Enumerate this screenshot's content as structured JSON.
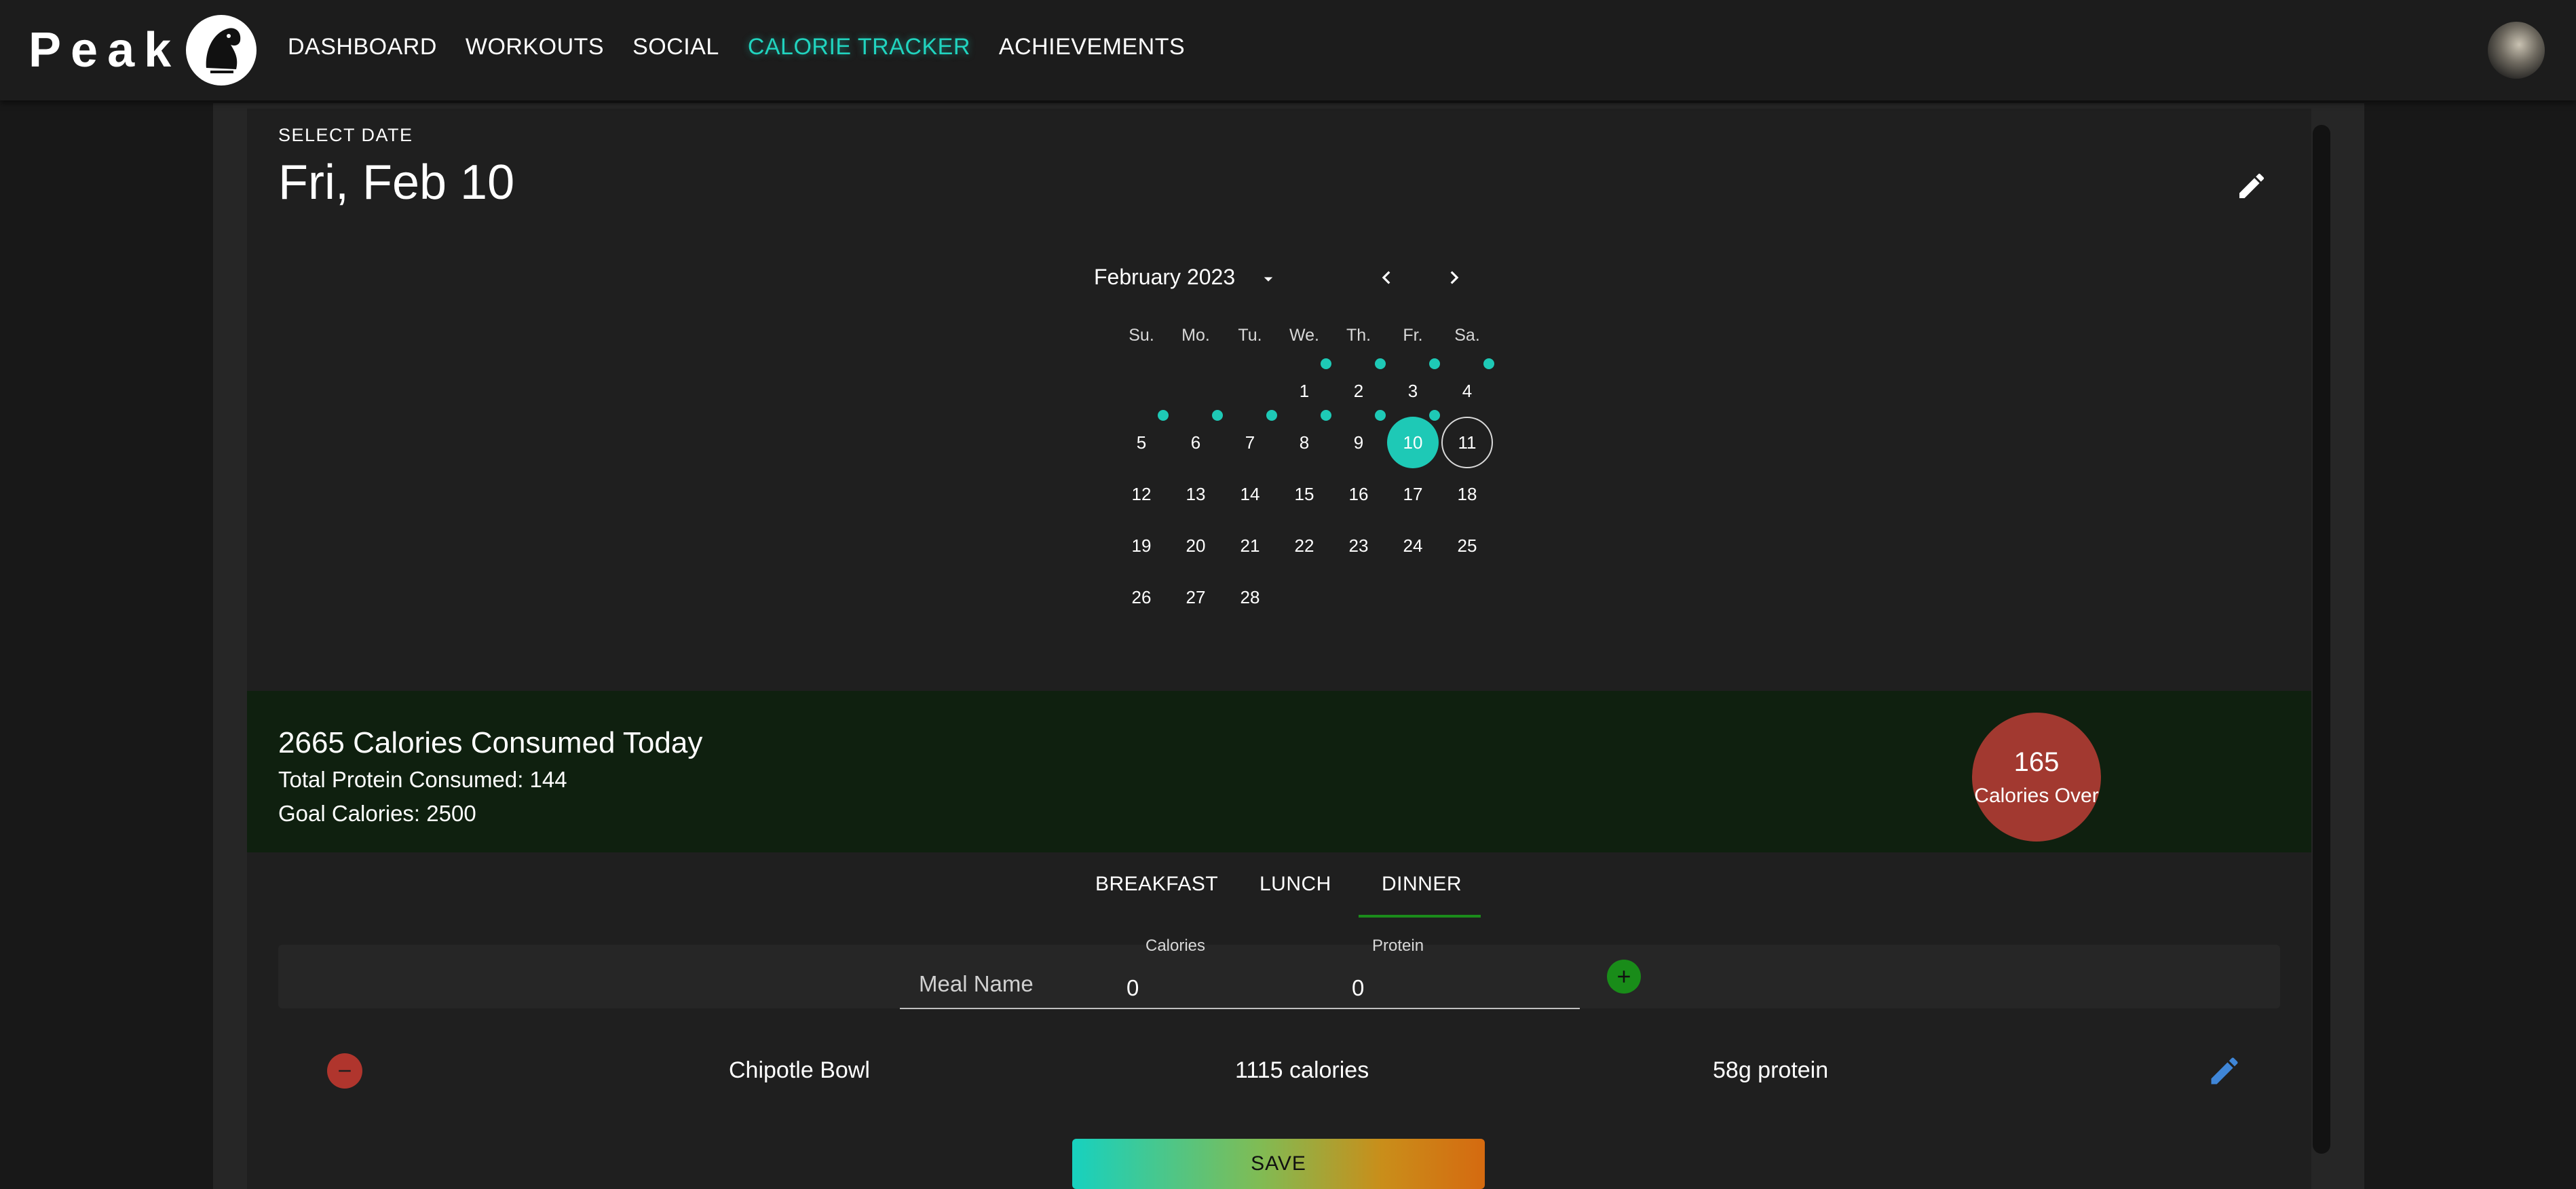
{
  "header": {
    "brand": "Peak",
    "nav": [
      {
        "label": "DASHBOARD"
      },
      {
        "label": "WORKOUTS"
      },
      {
        "label": "SOCIAL"
      },
      {
        "label": "CALORIE TRACKER",
        "active": true
      },
      {
        "label": "ACHIEVEMENTS"
      }
    ]
  },
  "date_picker": {
    "label": "SELECT DATE",
    "heading": "Fri, Feb 10",
    "month_label": "February 2023",
    "weekdays": [
      "Su.",
      "Mo.",
      "Tu.",
      "We.",
      "Th.",
      "Fr.",
      "Sa."
    ],
    "days": [
      "1",
      "2",
      "3",
      "4",
      "5",
      "6",
      "7",
      "8",
      "9",
      "10",
      "11",
      "12",
      "13",
      "14",
      "15",
      "16",
      "17",
      "18",
      "19",
      "20",
      "21",
      "22",
      "23",
      "24",
      "25",
      "26",
      "27",
      "28"
    ],
    "selected_day": "10",
    "today": "11",
    "logged_days": [
      "1",
      "2",
      "3",
      "4",
      "5",
      "6",
      "7",
      "8",
      "9",
      "10"
    ],
    "accent": "#1ec9b6"
  },
  "summary": {
    "calories_consumed": "2665 Calories Consumed Today",
    "protein": "Total Protein Consumed: 144",
    "goal": "Goal Calories: 2500",
    "over_value": "165",
    "over_label": "Calories Over",
    "over_color": "#a23930",
    "band_color": "#0f200f"
  },
  "tabs": [
    {
      "label": "BREAKFAST"
    },
    {
      "label": "LUNCH"
    },
    {
      "label": "DINNER",
      "active": true
    }
  ],
  "form": {
    "meal_placeholder": "Meal Name",
    "calories_label": "Calories",
    "calories_value": "0",
    "protein_label": "Protein",
    "protein_value": "0"
  },
  "entries": [
    {
      "name": "Chipotle Bowl",
      "calories": "1115 calories",
      "protein": "58g protein"
    }
  ],
  "save_label": "SAVE",
  "icons": {
    "edit": "pencil-icon",
    "add": "plus-icon",
    "remove": "minus-icon",
    "dropdown": "caret-down-icon",
    "prev": "chevron-left-icon",
    "next": "chevron-right-icon"
  }
}
